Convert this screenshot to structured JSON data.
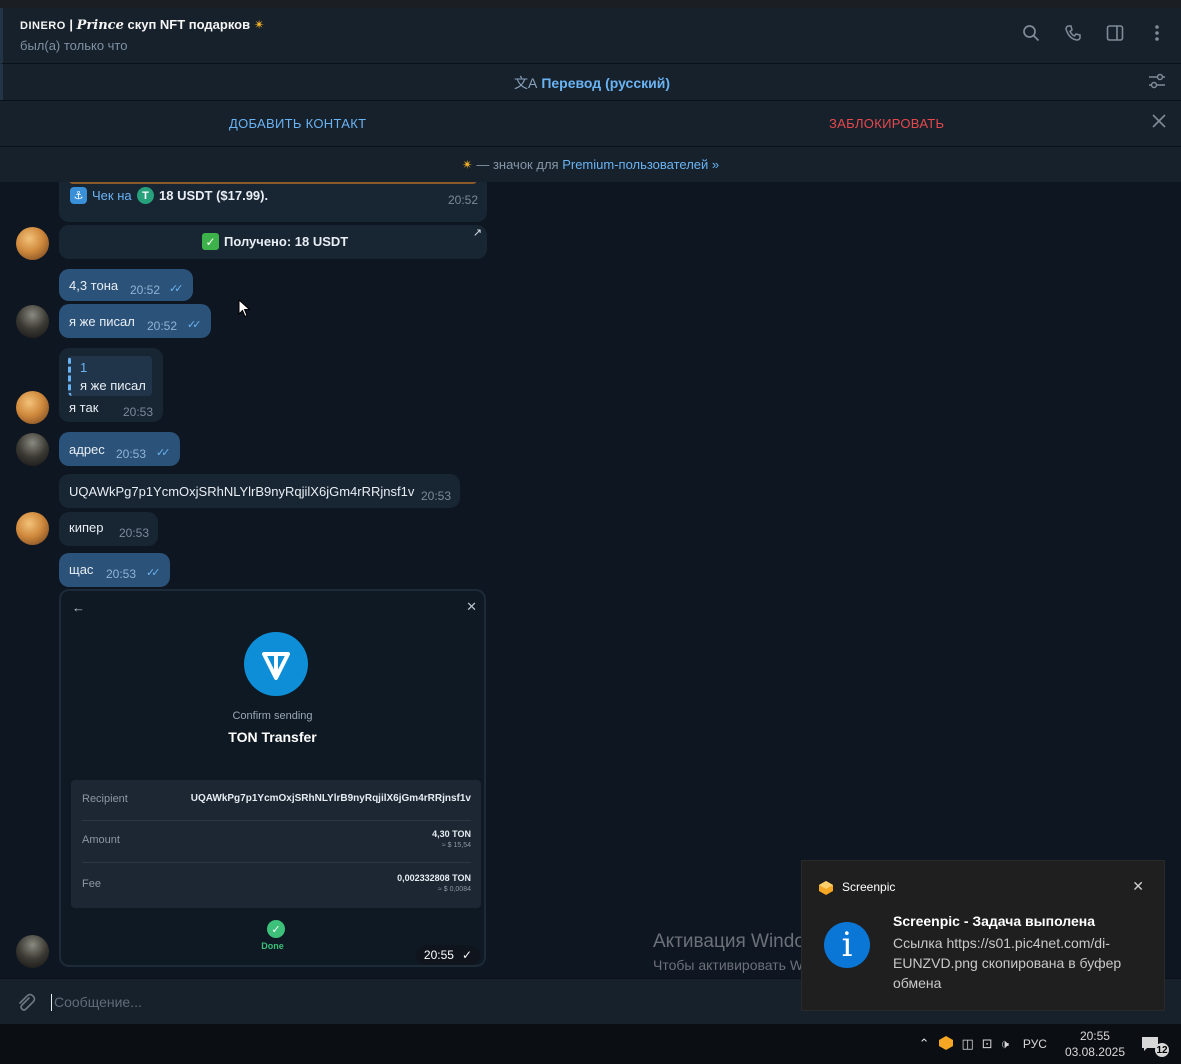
{
  "header": {
    "title_brand": "DINERO",
    "title_sep": " | ",
    "title_prince": "Prince",
    "title_rest": " скуп NFT подарков",
    "status": "был(а) только что"
  },
  "translate": {
    "label": "Перевод (русский)",
    "icon_glyph": "文A"
  },
  "actions": {
    "add_contact": "ДОБАВИТЬ КОНТАКТ",
    "block": "ЗАБЛОКИРОВАТЬ"
  },
  "premium": {
    "prefix": " — значок для ",
    "link": "Premium-пользователей »"
  },
  "messages": {
    "check": {
      "prefix": "Чек на",
      "amount": "18 USDT ($17.99).",
      "time": "20:52"
    },
    "received": {
      "text": "Получено: 18 USDT"
    },
    "m1": {
      "text": "4,3 тона",
      "time": "20:52"
    },
    "m2": {
      "text": "я же писал",
      "time": "20:52"
    },
    "m3": {
      "reply_name": "1",
      "reply_text": "я же писал",
      "text": "я так",
      "time": "20:53"
    },
    "m4": {
      "text": "адрес",
      "time": "20:53"
    },
    "m5": {
      "text": "UQAWkPg7p1YcmOxjSRhNLYlrB9nyRqjilX6jGm4rRRjnsf1v",
      "time": "20:53"
    },
    "m6": {
      "text": "кипер",
      "time": "20:53"
    },
    "m7": {
      "text": "щас",
      "time": "20:53"
    },
    "photo": {
      "time": "20:55",
      "confirm": "Confirm sending",
      "transfer": "TON Transfer",
      "recipient_label": "Recipient",
      "recipient_value": "UQAWkPg7p1YcmOxjSRhNLYlrB9nyRqjilX6jGm4rRRjnsf1v",
      "amount_label": "Amount",
      "amount_value": "4,30 TON",
      "amount_usd": "≈ $ 15,54",
      "fee_label": "Fee",
      "fee_value": "0,002332808 TON",
      "fee_usd": "≈ $ 0,0084",
      "done": "Done"
    }
  },
  "composer": {
    "placeholder": "Сообщение..."
  },
  "watermark": {
    "line1": "Активация Windows",
    "line2": "Чтобы активировать Windows, перейдите в раздел \"Параметры\"."
  },
  "toast": {
    "app": "Screenpic",
    "title": "Screenpic - Задача выполена",
    "body": "Ссылка https://s01.pic4net.com/di-EUNZVD.png скопирована в буфер обмена"
  },
  "taskbar": {
    "lang": "РУС",
    "time": "20:55",
    "date": "03.08.2025",
    "notifications": "12"
  },
  "colors": {
    "accent": "#6ab3f3",
    "danger": "#e5484d",
    "bg": "#0e1621",
    "bubble_in": "#182533",
    "bubble_out": "#2b5278"
  }
}
